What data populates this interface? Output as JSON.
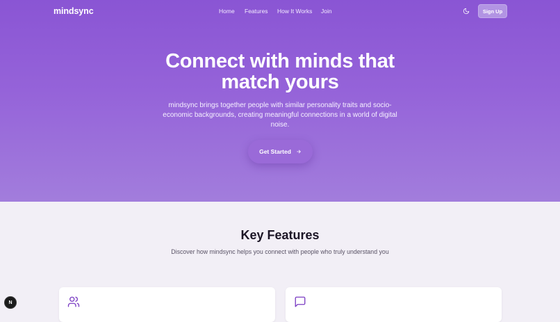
{
  "nav": {
    "logo": "mindsync",
    "links": [
      "Home",
      "Features",
      "How It Works",
      "Join"
    ],
    "theme_icon": "moon-icon",
    "signup_label": "Sign Up"
  },
  "hero": {
    "headline_line1": "Connect with minds that",
    "headline_line2": "match yours",
    "subtext": "mindsync brings together people with similar personality traits and socio-economic backgrounds, creating meaningful connections in a world of digital noise.",
    "cta_label": "Get Started",
    "cta_icon": "arrow-right-icon"
  },
  "features": {
    "title": "Key Features",
    "subtitle": "Discover how mindsync helps you connect with people who truly understand you",
    "cards": [
      {
        "icon": "users-icon"
      },
      {
        "icon": "message-square-icon"
      }
    ]
  },
  "devtools": {
    "badge": "N"
  },
  "colors": {
    "hero_top": "#8a55d4",
    "hero_bottom": "#a27ddc",
    "accent": "#7c3fc4",
    "background": "#f2eff6"
  }
}
